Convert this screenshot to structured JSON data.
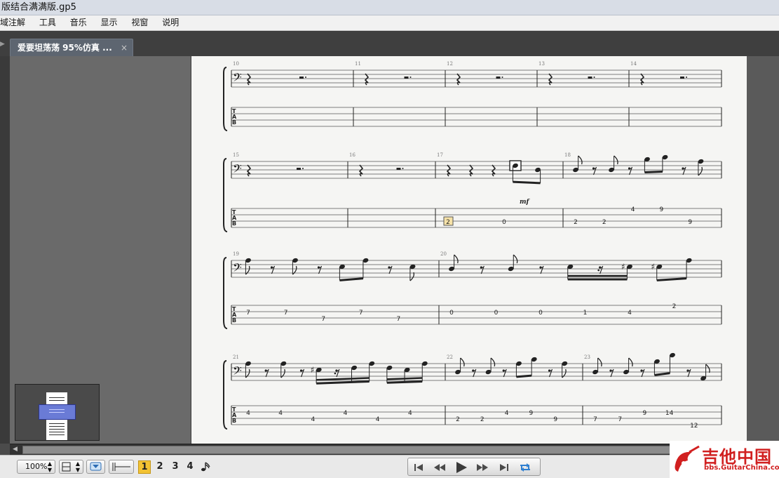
{
  "window": {
    "title": "版结合满满版.gp5"
  },
  "menu": [
    "域注解",
    "工具",
    "音乐",
    "显示",
    "视窗",
    "说明"
  ],
  "tab": {
    "label": "爱要坦荡荡 95%仿真 ...",
    "close": "×"
  },
  "toolbar": {
    "zoom": "100%",
    "voices": [
      "1",
      "2",
      "3",
      "4"
    ],
    "active_voice": "1"
  },
  "score": {
    "dynamic": "mf",
    "systems": [
      {
        "bars": [
          {
            "num": "10",
            "notes": [
              {
                "t": "qr"
              },
              {
                "t": "hr"
              }
            ],
            "tab": []
          },
          {
            "num": "11",
            "notes": [
              {
                "t": "qr"
              },
              {
                "t": "hr"
              }
            ],
            "tab": []
          },
          {
            "num": "12",
            "notes": [
              {
                "t": "qr"
              },
              {
                "t": "hr"
              }
            ],
            "tab": []
          },
          {
            "num": "13",
            "notes": [
              {
                "t": "qr"
              },
              {
                "t": "hr"
              }
            ],
            "tab": []
          },
          {
            "num": "14",
            "notes": [
              {
                "t": "qr"
              },
              {
                "t": "hr"
              }
            ],
            "tab": []
          }
        ]
      },
      {
        "bars": [
          {
            "num": "15",
            "notes": [
              {
                "t": "qr"
              },
              {
                "t": "hr"
              }
            ],
            "tab": []
          },
          {
            "num": "16",
            "notes": [
              {
                "t": "qr"
              },
              {
                "t": "hr"
              }
            ],
            "tab": []
          },
          {
            "num": "17",
            "notes": [
              {
                "t": "qr"
              },
              {
                "t": "qr"
              },
              {
                "t": "qr"
              },
              {
                "t": "e",
                "p": 2,
                "beam": "a",
                "sel": true
              },
              {
                "t": "e",
                "p": 4,
                "beam": "a"
              }
            ],
            "tab": [
              {
                "s": 3,
                "f": "2",
                "sel": true
              },
              {
                "s": 3,
                "f": "0"
              }
            ]
          },
          {
            "num": "18",
            "notes": [
              {
                "t": "e",
                "p": 4
              },
              {
                "t": "er"
              },
              {
                "t": "e",
                "p": 4
              },
              {
                "t": "er"
              },
              {
                "t": "e",
                "p": -1,
                "beam": "a"
              },
              {
                "t": "e",
                "p": -2,
                "beam": "a"
              },
              {
                "t": "er"
              },
              {
                "t": "e",
                "p": 0
              }
            ],
            "tab": [
              {
                "s": 3,
                "f": "2"
              },
              {
                "s": 3,
                "f": "2"
              },
              {
                "s": 1,
                "f": "4"
              },
              {
                "s": 1,
                "f": "9"
              },
              {
                "s": 3,
                "f": "9"
              }
            ]
          }
        ]
      },
      {
        "bars": [
          {
            "num": "19",
            "notes": [
              {
                "t": "e",
                "p": 0
              },
              {
                "t": "er"
              },
              {
                "t": "e",
                "p": 0
              },
              {
                "t": "er"
              },
              {
                "t": "e",
                "p": 3,
                "beam": "a"
              },
              {
                "t": "e",
                "p": 0,
                "beam": "a"
              },
              {
                "t": "er"
              },
              {
                "t": "e",
                "p": 3
              }
            ],
            "tab": [
              {
                "s": 2,
                "f": "7"
              },
              {
                "s": 2,
                "f": "7"
              },
              {
                "s": 3,
                "f": "7"
              },
              {
                "s": 2,
                "f": "7"
              },
              {
                "s": 3,
                "f": "7"
              }
            ]
          },
          {
            "num": "20",
            "notes": [
              {
                "t": "e",
                "p": 4
              },
              {
                "t": "er"
              },
              {
                "t": "e",
                "p": 4
              },
              {
                "t": "er"
              },
              {
                "t": "e",
                "p": 3,
                "beam": "b"
              },
              {
                "t": "sr",
                "beam": "b"
              },
              {
                "t": "s",
                "p": 3,
                "acc": "#",
                "beam": "b"
              },
              {
                "t": "e",
                "p": 3,
                "acc": "#",
                "beam": "c"
              },
              {
                "t": "e",
                "p": 0,
                "beam": "c"
              }
            ],
            "tab": [
              {
                "s": 2,
                "f": "0"
              },
              {
                "s": 2,
                "f": "0"
              },
              {
                "s": 2,
                "f": "0"
              },
              {
                "s": 2,
                "f": "1"
              },
              {
                "s": 2,
                "f": "4"
              },
              {
                "s": 1,
                "f": "2"
              }
            ]
          }
        ]
      },
      {
        "bars": [
          {
            "num": "21",
            "notes": [
              {
                "t": "e",
                "p": 0
              },
              {
                "t": "er"
              },
              {
                "t": "e",
                "p": 0
              },
              {
                "t": "er"
              },
              {
                "t": "s",
                "p": 3,
                "acc": "#",
                "beam": "a"
              },
              {
                "t": "sr",
                "beam": "a"
              },
              {
                "t": "s",
                "p": 2,
                "beam": "a"
              },
              {
                "t": "s",
                "p": 0,
                "beam": "a"
              },
              {
                "t": "s",
                "p": 2,
                "beam": "b"
              },
              {
                "t": "s",
                "p": 3,
                "beam": "b"
              },
              {
                "t": "s",
                "p": 0,
                "beam": "b"
              }
            ],
            "tab": [
              {
                "s": 2,
                "f": "4"
              },
              {
                "s": 2,
                "f": "4"
              },
              {
                "s": 3,
                "f": "4"
              },
              {
                "s": 2,
                "f": "4"
              },
              {
                "s": 3,
                "f": "4"
              },
              {
                "s": 2,
                "f": "4"
              }
            ]
          },
          {
            "num": "22",
            "notes": [
              {
                "t": "e",
                "p": 4
              },
              {
                "t": "er"
              },
              {
                "t": "e",
                "p": 4
              },
              {
                "t": "er"
              },
              {
                "t": "e",
                "p": 0,
                "beam": "a"
              },
              {
                "t": "e",
                "p": -2,
                "beam": "a"
              },
              {
                "t": "er"
              },
              {
                "t": "e",
                "p": 0
              }
            ],
            "tab": [
              {
                "s": 3,
                "f": "2"
              },
              {
                "s": 3,
                "f": "2"
              },
              {
                "s": 2,
                "f": "4"
              },
              {
                "s": 2,
                "f": "9"
              },
              {
                "s": 3,
                "f": "9"
              }
            ]
          },
          {
            "num": "23",
            "notes": [
              {
                "t": "e",
                "p": 4
              },
              {
                "t": "er"
              },
              {
                "t": "e",
                "p": 4
              },
              {
                "t": "er"
              },
              {
                "t": "e",
                "p": -1,
                "beam": "a"
              },
              {
                "t": "e",
                "p": -4,
                "beam": "a"
              },
              {
                "t": "er"
              },
              {
                "t": "e",
                "p": 7
              }
            ],
            "tab": [
              {
                "s": 3,
                "f": "7"
              },
              {
                "s": 3,
                "f": "7"
              },
              {
                "s": 2,
                "f": "9"
              },
              {
                "s": 2,
                "f": "14"
              },
              {
                "s": 4,
                "f": "12"
              }
            ]
          }
        ]
      }
    ]
  },
  "watermark": {
    "title": "吉他中国",
    "url": "bbs.GuitarChina.com"
  }
}
